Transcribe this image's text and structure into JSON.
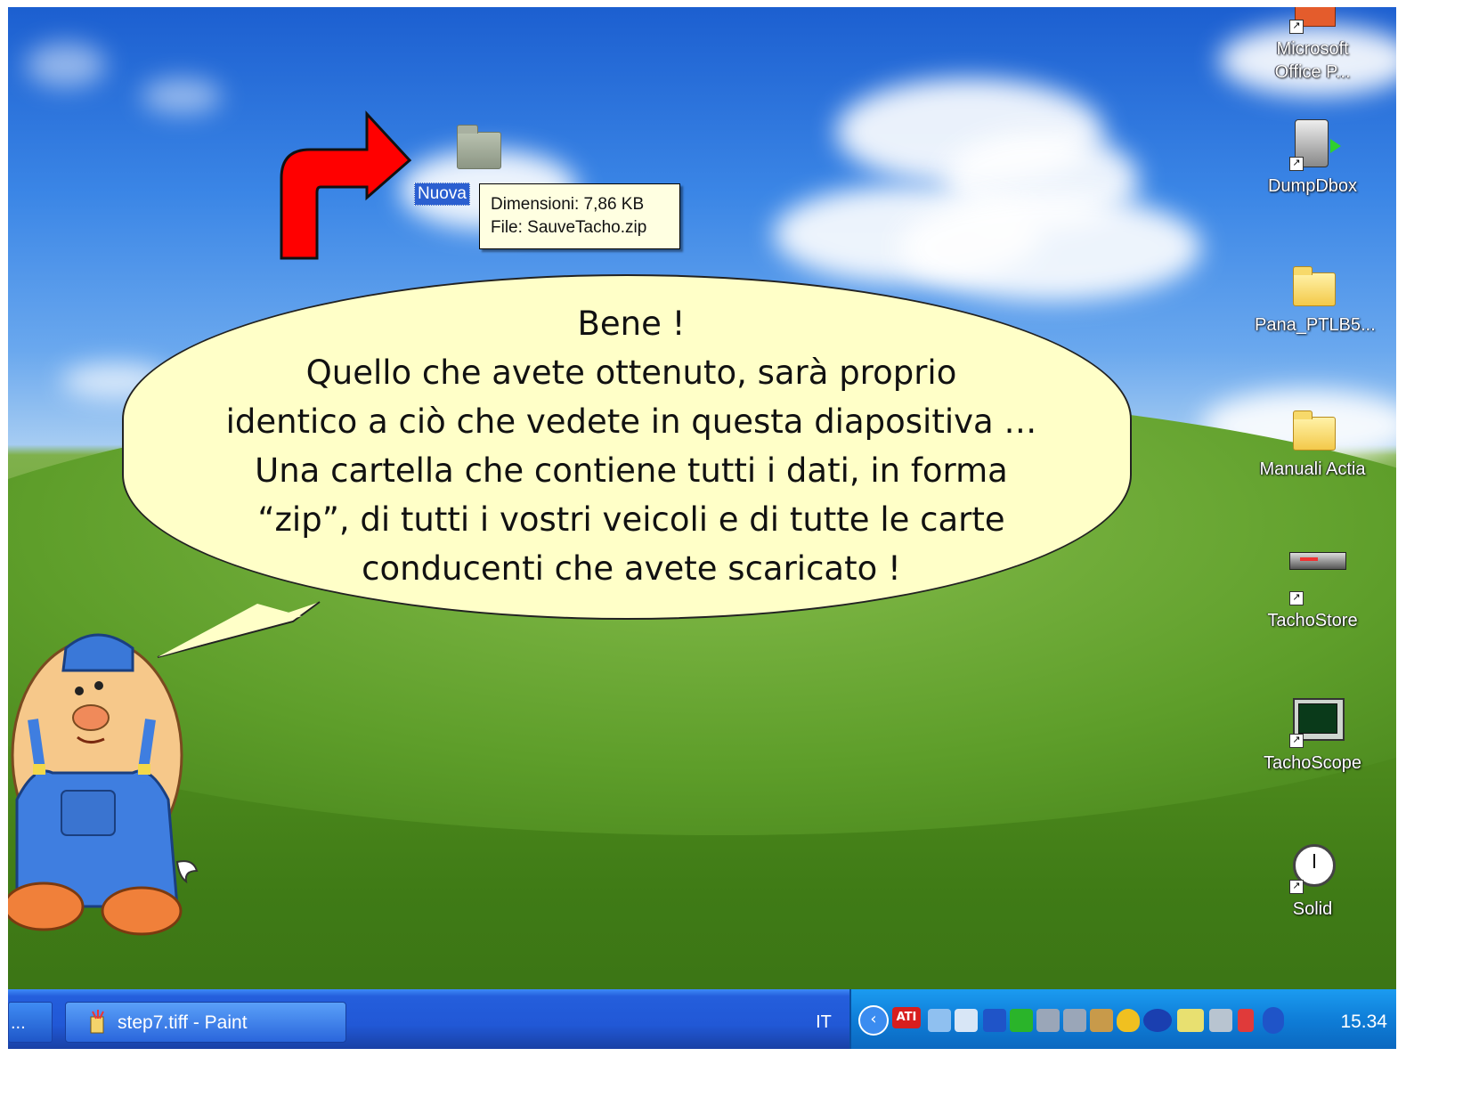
{
  "desktop": {
    "icons": [
      {
        "label_line1": "Microsoft",
        "label_line2": "Office P...",
        "icon": "powerpoint-shortcut-icon"
      },
      {
        "label": "DumpDbox",
        "icon": "dumpdbox-shortcut-icon"
      },
      {
        "label": "Pana_PTLB5...",
        "icon": "folder-icon"
      },
      {
        "label": "Manuali Actia",
        "icon": "folder-icon"
      },
      {
        "label": "TachoStore",
        "icon": "tachostore-shortcut-icon"
      },
      {
        "label": "TachoScope",
        "icon": "tachoscope-shortcut-icon"
      },
      {
        "label": "Solid",
        "icon": "stopwatch-shortcut-icon"
      }
    ],
    "selected_folder": {
      "label": "Nuova",
      "icon": "folder-icon"
    },
    "tooltip": {
      "line1": "Dimensioni: 7,86 KB",
      "line2": "File: SauveTacho.zip"
    }
  },
  "bubble": {
    "lines": [
      "Bene !",
      "Quello che avete ottenuto, sarà proprio",
      "identico a ciò che vedete in questa diapositiva …",
      "Una cartella che contiene tutti i dati, in forma",
      "“zip”, di tutti i vostri veicoli e di tutte le  carte",
      "conducenti che avete scaricato !"
    ]
  },
  "taskbar": {
    "prev_button_label": "...",
    "paint_button_label": "step7.tiff - Paint",
    "language": "IT",
    "tray_badge": "ATI",
    "clock": "15.34"
  },
  "colors": {
    "bubble_fill": "#ffffc8",
    "arrow": "#ff0000",
    "taskbar": "#245edc",
    "tray": "#0f7ed8"
  }
}
